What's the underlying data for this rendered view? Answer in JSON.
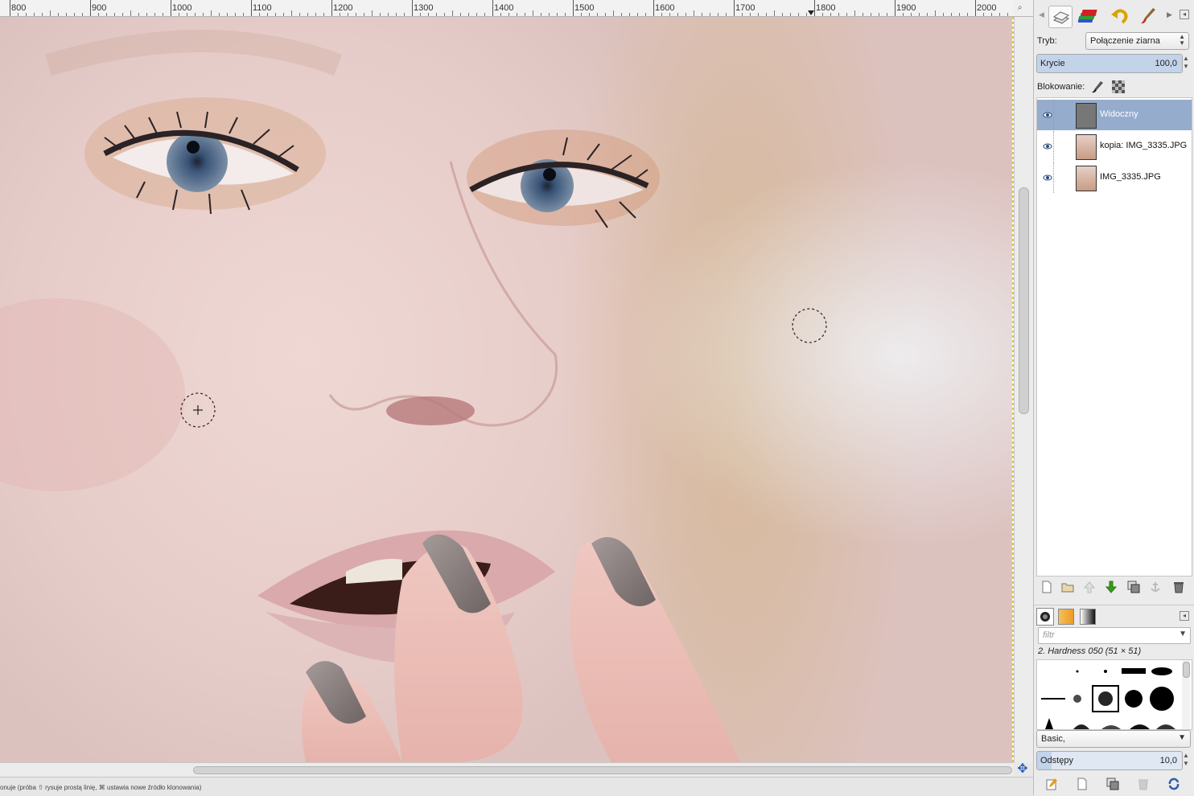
{
  "ruler": {
    "labels": [
      "800",
      "900",
      "1000",
      "1100",
      "1200",
      "1300",
      "1400",
      "1500",
      "1600",
      "1700",
      "1800",
      "1900",
      "2000"
    ]
  },
  "status": {
    "text": "onuje (próba ⇧ rysuje prostą linię, ⌘ ustawia nowe źródło klonowania)"
  },
  "dock": {
    "tabs": [
      "layers-tab",
      "channels-tab",
      "undo-history-tab",
      "paint-tool-tab"
    ],
    "mode_label": "Tryb:",
    "mode_value": "Połączenie ziarna",
    "opacity_label": "Krycie",
    "opacity_value": "100,0",
    "opacity_fraction": 1.0,
    "lock_label": "Blokowanie:",
    "layers": [
      {
        "name": "Widoczny",
        "selected": true,
        "visible": true,
        "thumb": "gray"
      },
      {
        "name": "kopia: IMG_3335.JPG",
        "selected": false,
        "visible": true,
        "thumb": "photo"
      },
      {
        "name": "IMG_3335.JPG",
        "selected": false,
        "visible": true,
        "thumb": "photo"
      }
    ],
    "layer_buttons": [
      "new-layer",
      "new-layer-group",
      "raise-layer",
      "lower-layer",
      "duplicate-layer",
      "anchor-layer",
      "delete-layer"
    ]
  },
  "brushes": {
    "filter_placeholder": "filtr",
    "selected_brush": "2. Hardness 050 (51 × 51)",
    "preset": "Basic,",
    "spacing_label": "Odstępy",
    "spacing_value": "10,0",
    "spacing_fraction": 0.1
  },
  "colors": {
    "selection": "#95accd",
    "accent_blue": "#2a5fb0",
    "arrow_green": "#3a9a1a"
  }
}
